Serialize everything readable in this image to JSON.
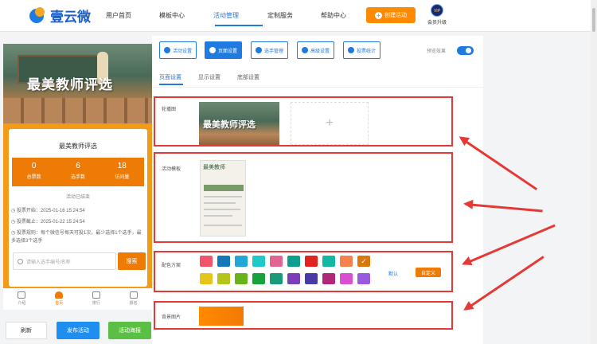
{
  "brand": {
    "name": "壹云微"
  },
  "nav": {
    "items": [
      "用户首页",
      "模板中心",
      "活动管理",
      "定制服务",
      "帮助中心"
    ],
    "create_label": "创建活动",
    "vip_badge": "VIP",
    "vip_label": "会员升级"
  },
  "phone": {
    "banner_title": "最美教师评选",
    "activity_title": "最美教师评选",
    "stats": [
      {
        "value": "0",
        "label": "总票数"
      },
      {
        "value": "6",
        "label": "选手数"
      },
      {
        "value": "18",
        "label": "访问量"
      }
    ],
    "status": "活动已结束",
    "vote_start": "投票开始：2025-01-16 15:24:54",
    "vote_end": "投票截止：2025-01-22 15:24:54",
    "vote_rule": "投票规则：每个微信号每天可投1次，最少选择1个选手，最多选择3个选手",
    "search_placeholder": "请输入选手编号/名称",
    "search_button": "搜索",
    "tabs": [
      "介绍",
      "首页",
      "排行",
      "报名"
    ],
    "active_tab": "首页"
  },
  "bottom_buttons": {
    "refresh": "刷新",
    "publish": "发布活动",
    "poster": "活动海报"
  },
  "toolbar": {
    "buttons": [
      "活动设置",
      "页面设置",
      "选手管理",
      "高级设置",
      "投票统计"
    ],
    "active": "页面设置",
    "preview_label": "预览效果",
    "preview_on": true
  },
  "subtabs": {
    "items": [
      "页面设置",
      "显示设置",
      "底部设置"
    ],
    "active": "页面设置"
  },
  "sections": {
    "carousel_label": "轮播图",
    "carousel_image_text": "最美教师评选",
    "upload_plus": "+",
    "template_label": "活动模板",
    "template_thumb_title": "最美教师",
    "color_label": "配色方案",
    "color_default": "默认",
    "color_custom": "自定义",
    "bg_label": "背景图片"
  },
  "colors": {
    "accent": "#1f7be0",
    "orange": "#ee7b05",
    "red_outline": "#e53935",
    "swatch_row1": [
      "#f2556b",
      "#1278b8",
      "#22a7d6",
      "#1fc9c9",
      "#e26493",
      "#0e9e8e",
      "#e0231e",
      "#13b8a3",
      "#f7814d",
      "#d9780c"
    ],
    "swatch_row2": [
      "#e7c41b",
      "#b6c41a",
      "#68b21c",
      "#17a23a",
      "#1a9a7a",
      "#7a3eb8",
      "#4a3aa8",
      "#b0287a",
      "#d84fd0",
      "#9a5ae0"
    ],
    "selected_swatch_index": 9,
    "selected_mark": "✓"
  }
}
